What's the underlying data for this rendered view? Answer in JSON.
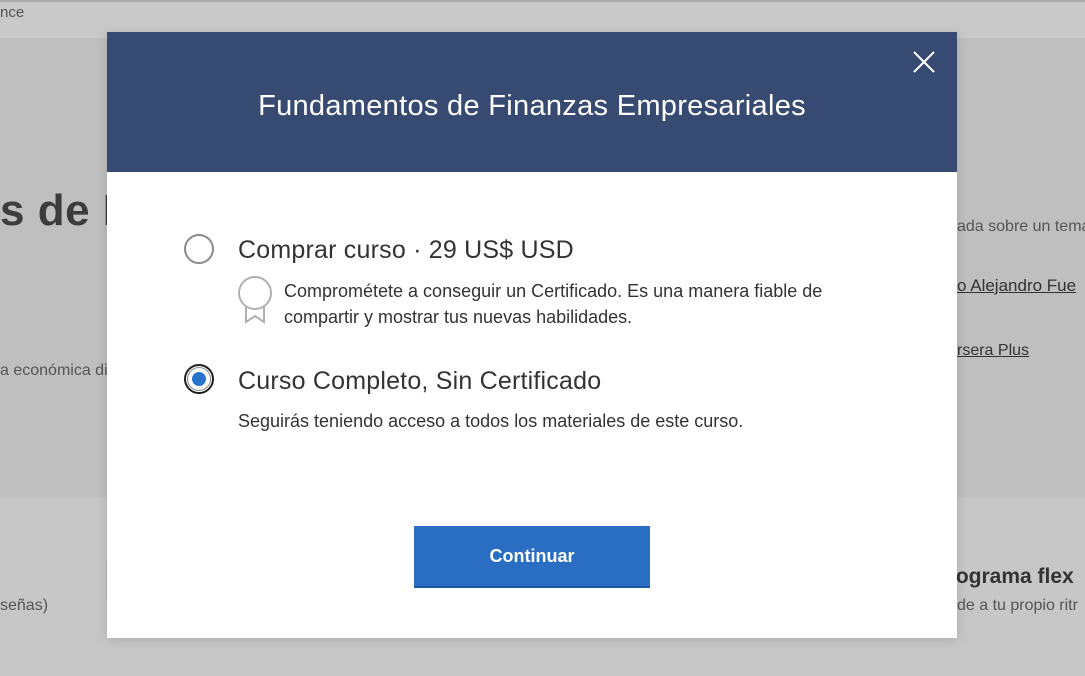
{
  "background": {
    "topbar_text": "nce",
    "title_fragment": "s de F",
    "desc_fragment": "a económica di",
    "sub_fragment": "señas)",
    "right_line1": "ada sobre un tema",
    "right_link1": "o Alejandro Fue",
    "right_link2": "rsera Plus",
    "right_heading": "nograma flex",
    "right_sub": "de a tu propio ritr"
  },
  "modal": {
    "title": "Fundamentos de Finanzas Empresariales",
    "close_icon": "close-icon",
    "options": [
      {
        "label": "Comprar curso · 29 US$ USD",
        "description": "Comprométete a conseguir un Certificado. Es una manera fiable de compartir y mostrar tus nuevas habilidades.",
        "icon": "certificate-ribbon-icon",
        "selected": false
      },
      {
        "label": "Curso Completo, Sin Certificado",
        "description": "Seguirás teniendo acceso a todos los materiales de este curso.",
        "selected": true
      }
    ],
    "continue_label": "Continuar"
  },
  "colors": {
    "header_bg": "#374a72",
    "accent": "#2a6ec4",
    "overlay": "#bdbdbd"
  }
}
